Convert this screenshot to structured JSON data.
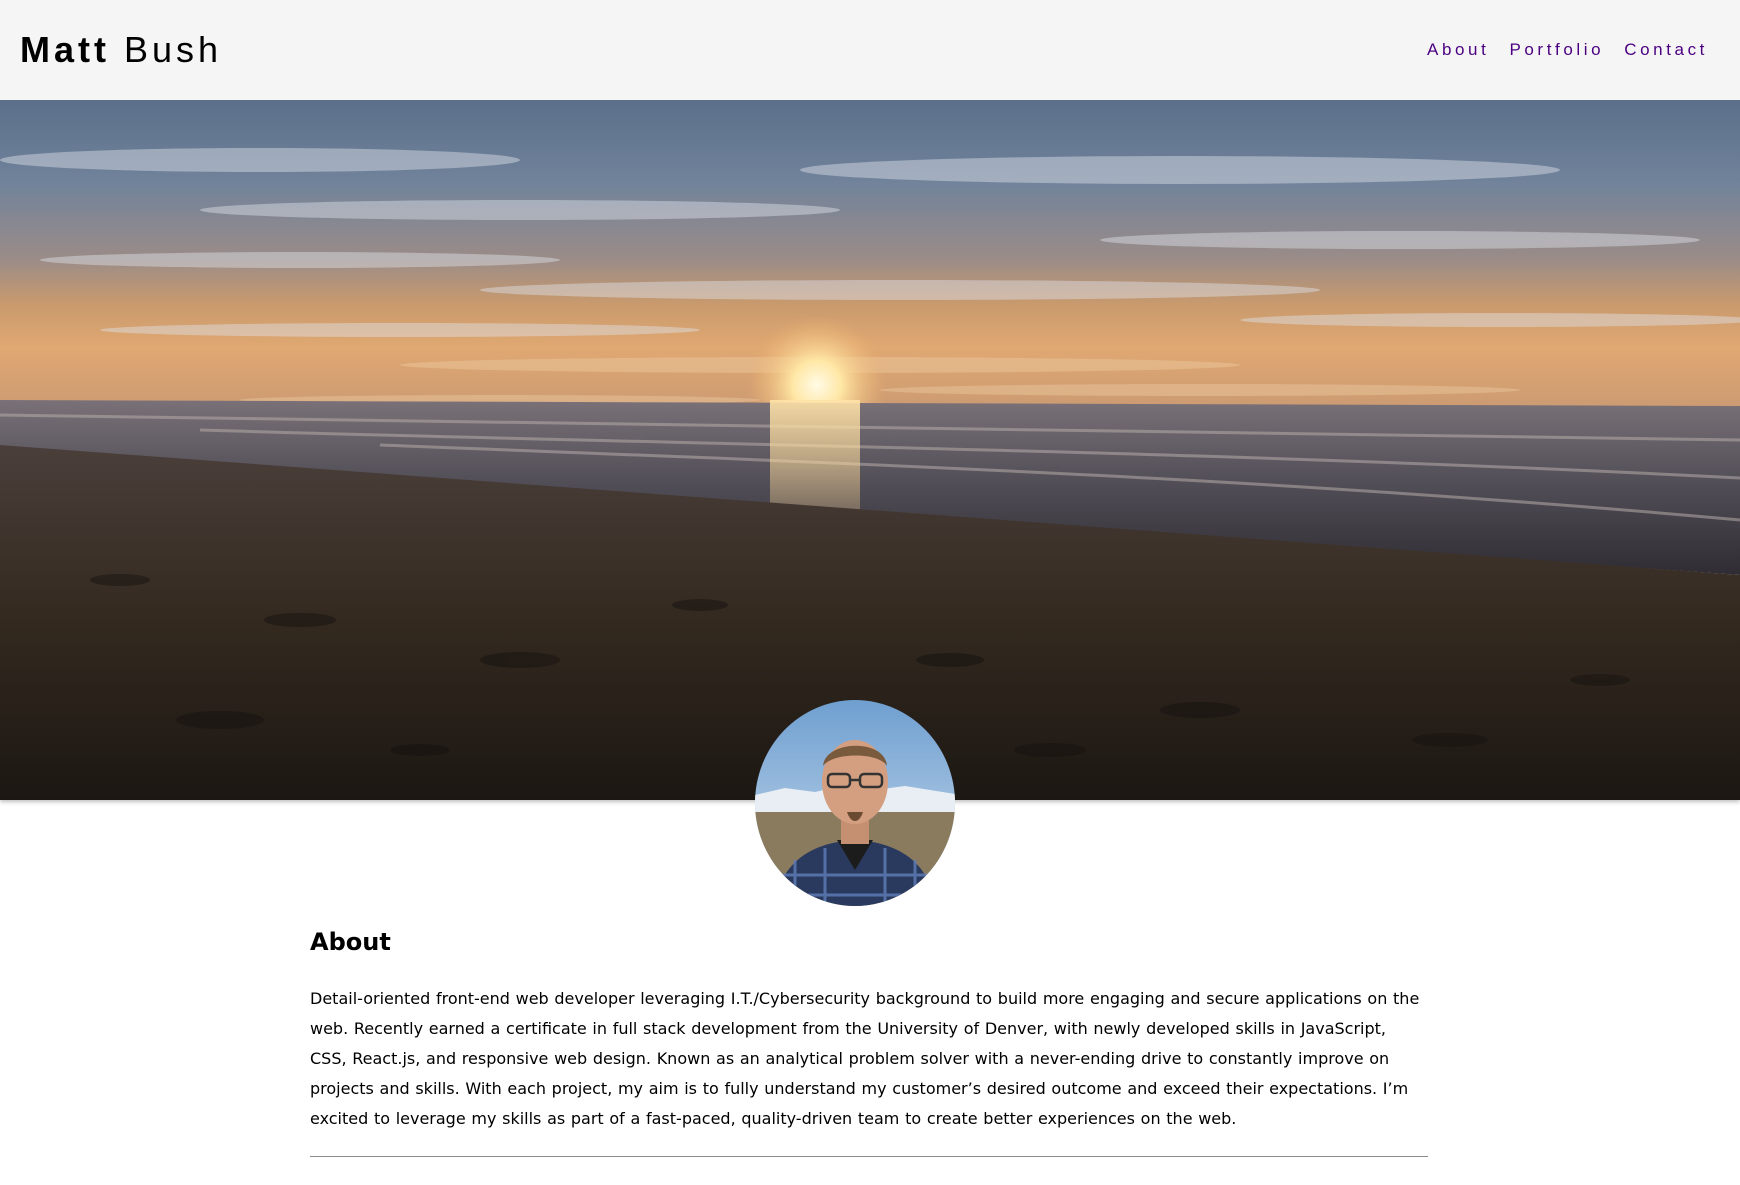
{
  "header": {
    "first_name": "Matt",
    "last_name": "Bush",
    "nav": [
      {
        "label": "About"
      },
      {
        "label": "Portfolio"
      },
      {
        "label": "Contact"
      }
    ],
    "nav_color": "#4b0082",
    "background": "#f5f5f5"
  },
  "hero": {
    "image": "beach-sunset-photo"
  },
  "avatar": {
    "image": "profile-photo"
  },
  "about": {
    "title": "About",
    "body": "Detail-oriented front-end web developer leveraging I.T./Cybersecurity background to build more engaging and secure applications on the web. Recently earned a certificate in full stack development from the University of Denver, with newly developed skills in JavaScript, CSS, React.js, and responsive web design. Known as an analytical problem solver with a never-ending drive to constantly improve on projects and skills. With each project, my aim is to fully understand my customer’s desired outcome and exceed their expectations. I’m excited to leverage my skills as part of a fast-paced, quality-driven team to create better experiences on the web."
  }
}
